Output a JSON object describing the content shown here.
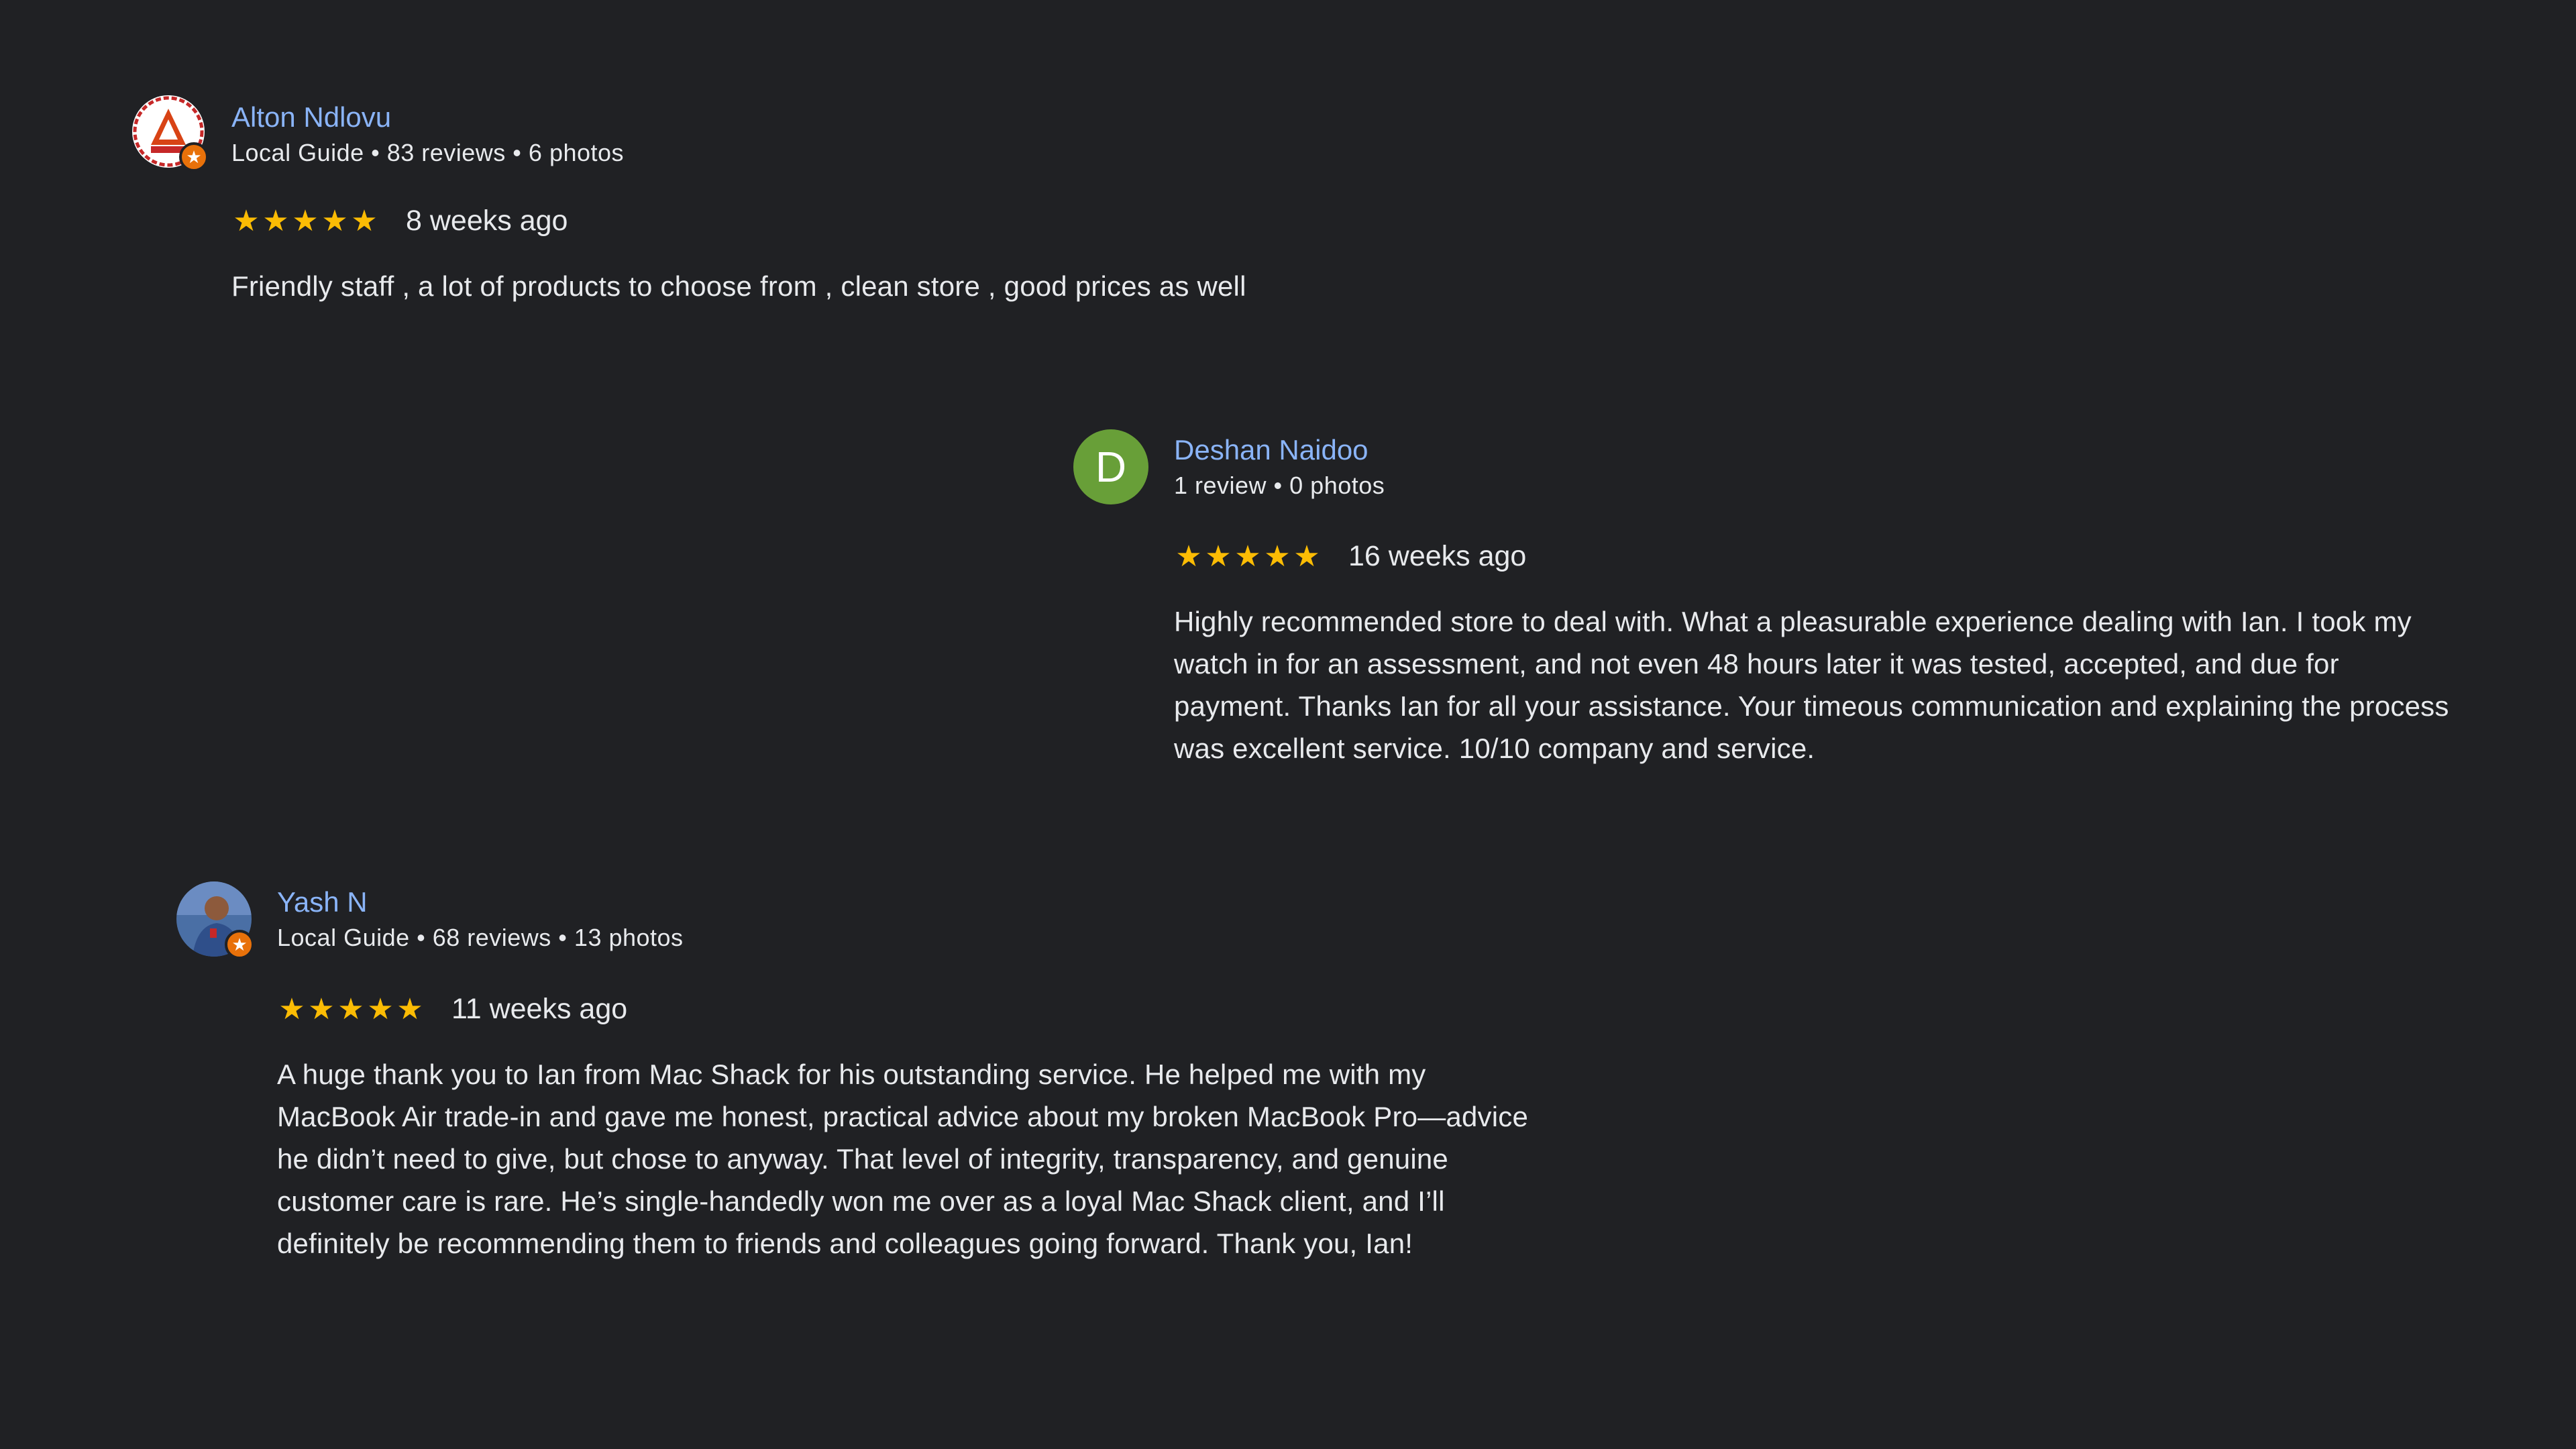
{
  "colors": {
    "background": "#202124",
    "name": "#8ab4f8",
    "text": "#e8eaed",
    "star": "#fbbc04",
    "local_guide_badge": "#e8710a",
    "avatar_d": "#689f38"
  },
  "reviews": [
    {
      "name": "Alton Ndlovu",
      "meta": "Local Guide • 83 reviews • 6 photos",
      "rating": 5,
      "date": "8 weeks ago",
      "text": "Friendly staff , a lot of products to choose from , clean store , good prices as well",
      "avatar_icon": "logo-avatar-icon",
      "local_guide": true
    },
    {
      "name": "Deshan Naidoo",
      "meta": "1 review • 0 photos",
      "rating": 5,
      "date": "16 weeks ago",
      "text": "Highly recommended store to deal with. What a pleasurable experience dealing with Ian. I took my watch in for an assessment, and not even 48 hours later it was tested, accepted, and due for payment. Thanks Ian for all your assistance. Your timeous communication and explaining the process was excellent service. 10/10 company and service.",
      "avatar_letter": "D",
      "local_guide": false
    },
    {
      "name": "Yash N",
      "meta": "Local Guide • 68 reviews • 13 photos",
      "rating": 5,
      "date": "11 weeks ago",
      "text": "A huge thank you to Ian from Mac Shack for his outstanding service. He helped me with my MacBook Air trade-in and gave me honest, practical advice about my broken MacBook Pro—advice he didn’t need to give, but chose to anyway. That level of integrity, transparency, and genuine customer care is rare. He’s single-handedly won me over as a loyal Mac Shack client, and I’ll definitely be recommending them to friends and colleagues going forward. Thank you, Ian!",
      "avatar_icon": "photo-avatar-icon",
      "local_guide": true
    }
  ],
  "star_glyph": "★",
  "badge_glyph": "★"
}
